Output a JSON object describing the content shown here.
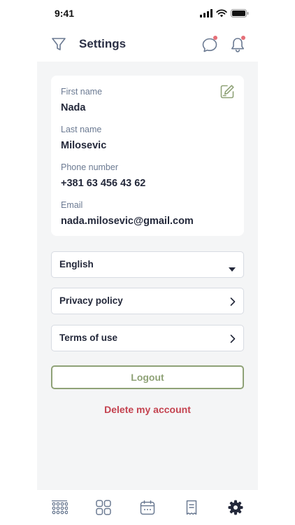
{
  "status_bar": {
    "time": "9:41",
    "icons": [
      "signal-icon",
      "wifi-icon",
      "battery-icon"
    ]
  },
  "header": {
    "title": "Settings",
    "left_icon": "filter-icon",
    "right_icons": [
      "chat-icon",
      "bell-icon"
    ],
    "notification_dots": true
  },
  "profile": {
    "first_name_label": "First name",
    "first_name": "Nada",
    "last_name_label": "Last name",
    "last_name": "Milosevic",
    "phone_label": "Phone number",
    "phone": "+381 63 456 43 62",
    "email_label": "Email",
    "email": "nada.milosevic@gmail.com",
    "edit_icon": "edit-icon"
  },
  "language": {
    "selected": "English"
  },
  "menu": {
    "privacy_label": "Privacy policy",
    "terms_label": "Terms of use"
  },
  "actions": {
    "logout_label": "Logout",
    "delete_label": "Delete my account"
  },
  "tab_bar": {
    "tabs": [
      "grid-dots-icon",
      "apps-icon",
      "calendar-icon",
      "receipt-icon",
      "gear-icon"
    ],
    "active": "gear-icon"
  },
  "colors": {
    "accent_green": "#8fa277",
    "danger_red": "#c4424f",
    "notification_dot": "#e56f78",
    "text_dark": "#24293b",
    "label_gray": "#6b7a92",
    "background_gray": "#f4f5f6"
  }
}
